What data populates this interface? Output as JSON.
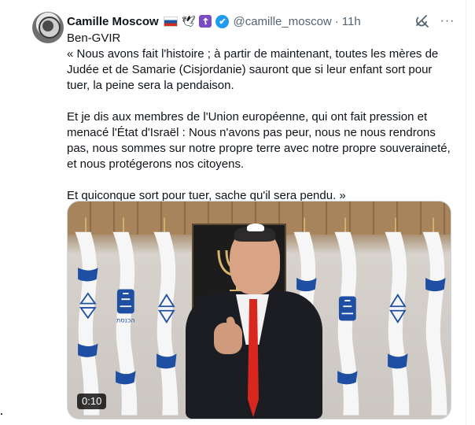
{
  "tweet": {
    "author_name": "Camille Moscow",
    "emoji_1": "🇷🇺",
    "emoji_2": "🕊",
    "emoji_3": "☦",
    "verified_icon": "✔",
    "handle": "@camille_moscow",
    "separator": "·",
    "time": "11h",
    "more_icon": "···",
    "text_lines": [
      "Ben-GVIR",
      "« Nous avons fait l'histoire ; à partir de maintenant, toutes les mères de Judée et de Samarie (Cisjordanie) sauront que si leur enfant sort pour tuer, la peine sera la pendaison.",
      "Et je dis aux membres de l'Union européenne, qui ont fait pression et menacé l'État d'Israël : Nous n'avons pas peur, nous ne nous rendrons pas, nous sommes sur notre propre terre avec notre propre souveraineté, et nous protégerons nos citoyens.",
      "Et quiconque sort pour tuer, sache qu'il sera pendu. »"
    ],
    "media": {
      "duration": "0:10",
      "flag_emblem_text": "הכנסת"
    }
  },
  "colors": {
    "text_primary": "#0f1419",
    "text_secondary": "#536471",
    "accent": "#1d9bf0",
    "flag_blue": "#1f4fa3"
  },
  "icons": {
    "grok": "grok-icon",
    "more": "more-icon",
    "verified": "verified-icon"
  }
}
